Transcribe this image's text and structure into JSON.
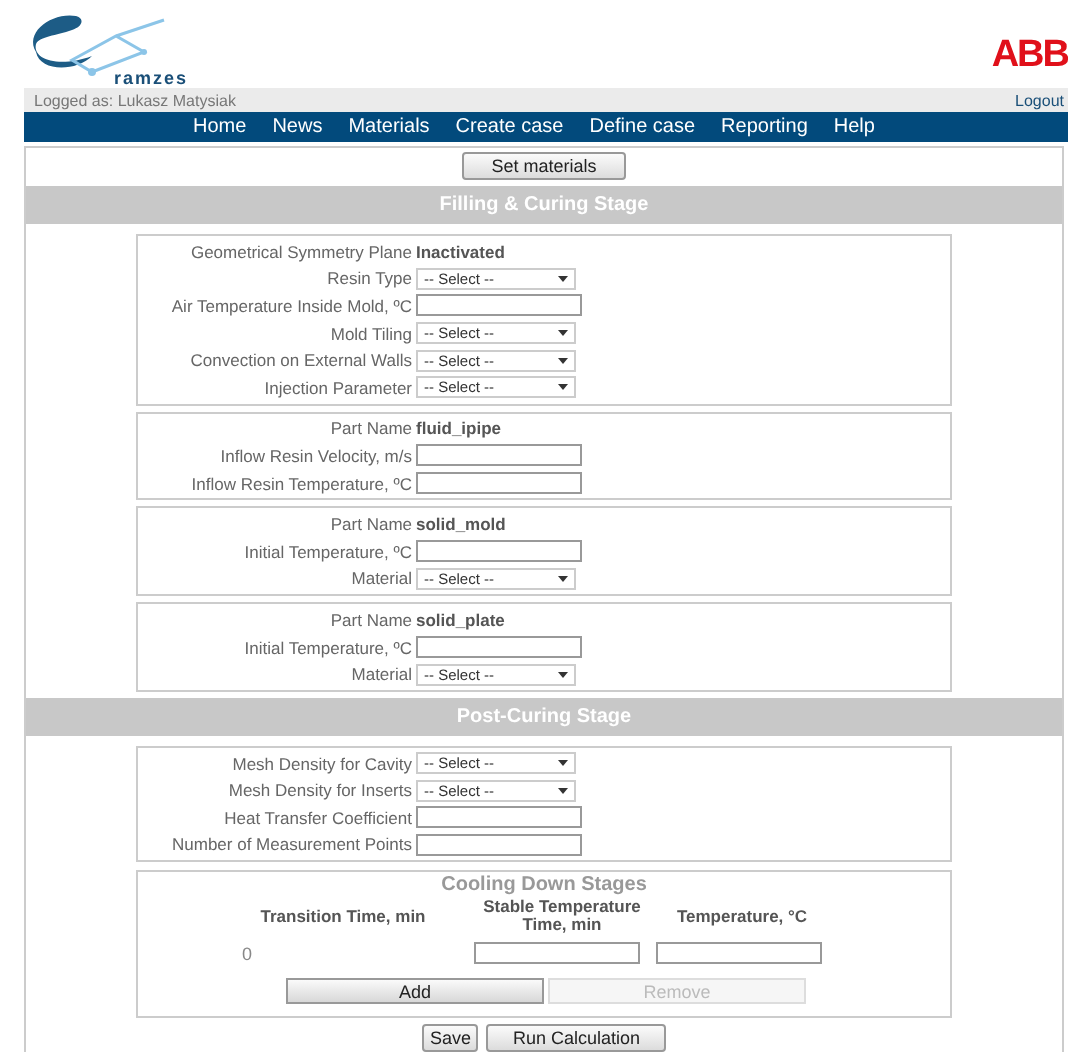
{
  "header": {
    "logo_text": "ramzes",
    "brand": "ABB",
    "user": "Logged as: Lukasz Matysiak",
    "logout": "Logout"
  },
  "nav": [
    "Home",
    "News",
    "Materials",
    "Create case",
    "Define case",
    "Reporting",
    "Help"
  ],
  "set_materials_button": "Set materials",
  "sections": [
    {
      "title": "Filling & Curing Stage",
      "panels": [
        {
          "rows": [
            {
              "kind": "value",
              "label": "Geometrical Symmetry Plane",
              "value": "Inactivated"
            },
            {
              "kind": "select",
              "label": "Resin Type",
              "value": "-- Select --"
            },
            {
              "kind": "input",
              "label": "Air Temperature Inside Mold, ºC"
            },
            {
              "kind": "select",
              "label": "Mold Tiling",
              "value": "-- Select --"
            },
            {
              "kind": "select",
              "label": "Convection on External Walls",
              "value": "-- Select --"
            },
            {
              "kind": "select",
              "label": "Injection Parameter",
              "value": "-- Select --"
            }
          ]
        },
        {
          "rows": [
            {
              "kind": "value",
              "label": "Part Name",
              "value": "fluid_ipipe"
            },
            {
              "kind": "input",
              "label": "Inflow Resin Velocity, m/s"
            },
            {
              "kind": "input",
              "label": "Inflow Resin Temperature, ºC"
            }
          ]
        },
        {
          "rows": [
            {
              "kind": "value",
              "label": "Part Name",
              "value": "solid_mold"
            },
            {
              "kind": "input",
              "label": "Initial Temperature, ºC"
            },
            {
              "kind": "select",
              "label": "Material",
              "value": "-- Select --"
            }
          ]
        },
        {
          "rows": [
            {
              "kind": "value",
              "label": "Part Name",
              "value": "solid_plate"
            },
            {
              "kind": "input",
              "label": "Initial Temperature, ºC"
            },
            {
              "kind": "select",
              "label": "Material",
              "value": "-- Select --"
            }
          ]
        }
      ]
    },
    {
      "title": "Post-Curing Stage",
      "panels": [
        {
          "rows": [
            {
              "kind": "select",
              "label": "Mesh Density for Cavity",
              "value": "-- Select --"
            },
            {
              "kind": "select",
              "label": "Mesh Density for Inserts",
              "value": "-- Select --"
            },
            {
              "kind": "input",
              "label": "Heat Transfer Coefficient"
            },
            {
              "kind": "input",
              "label": "Number of Measurement Points"
            }
          ]
        }
      ]
    }
  ],
  "cooling": {
    "title": "Cooling Down Stages",
    "columns": [
      "Transition Time, min",
      "Stable Temperature Time, min",
      "Temperature, °C"
    ],
    "rows": [
      {
        "transition": "0"
      }
    ],
    "buttons": [
      {
        "label": "Add",
        "disabled": false
      },
      {
        "label": "Remove",
        "disabled": true
      }
    ]
  },
  "footer_buttons": [
    "Save",
    "Run Calculation"
  ]
}
